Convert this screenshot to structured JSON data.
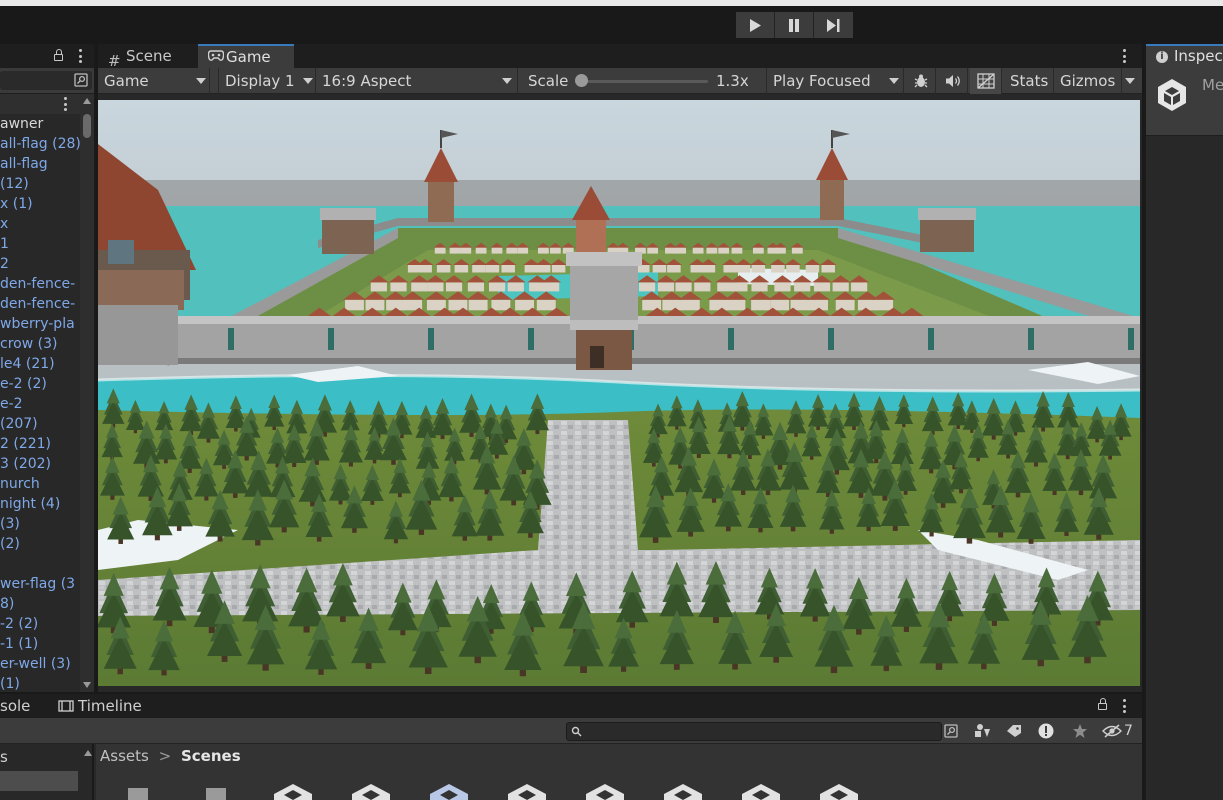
{
  "toolbar": {
    "play_icon": "play-icon",
    "pause_icon": "pause-icon",
    "step_icon": "step-icon"
  },
  "hierarchy": {
    "items": [
      {
        "label": "awner",
        "color": "white"
      },
      {
        "label": "all-flag (28)",
        "color": "blue"
      },
      {
        "label": "all-flag",
        "color": "blue"
      },
      {
        "label": "(12)",
        "color": "blue"
      },
      {
        "label": "x (1)",
        "color": "blue"
      },
      {
        "label": "x",
        "color": "blue"
      },
      {
        "label": "1",
        "color": "blue"
      },
      {
        "label": "2",
        "color": "blue"
      },
      {
        "label": "den-fence-",
        "color": "blue"
      },
      {
        "label": "den-fence-",
        "color": "blue"
      },
      {
        "label": "wberry-pla",
        "color": "blue"
      },
      {
        "label": "crow (3)",
        "color": "blue"
      },
      {
        "label": "le4 (21)",
        "color": "blue"
      },
      {
        "label": "e-2 (2)",
        "color": "blue"
      },
      {
        "label": "e-2",
        "color": "blue"
      },
      {
        "label": " (207)",
        "color": "blue"
      },
      {
        "label": "2 (221)",
        "color": "blue"
      },
      {
        "label": "3 (202)",
        "color": "blue"
      },
      {
        "label": "nurch",
        "color": "blue"
      },
      {
        "label": "night (4)",
        "color": "blue"
      },
      {
        "label": "(3)",
        "color": "blue"
      },
      {
        "label": "(2)",
        "color": "blue"
      },
      {
        "label": "",
        "color": "blue"
      },
      {
        "label": "wer-flag (3",
        "color": "blue"
      },
      {
        "label": "8)",
        "color": "blue"
      },
      {
        "label": "-2 (2)",
        "color": "blue"
      },
      {
        "label": "-1 (1)",
        "color": "blue"
      },
      {
        "label": "er-well (3)",
        "color": "blue"
      },
      {
        "label": " (1)",
        "color": "blue"
      }
    ]
  },
  "game": {
    "tabs": {
      "scene": "Scene",
      "game": "Game"
    },
    "controls": {
      "view": "Game",
      "display": "Display 1",
      "aspect": "16:9 Aspect",
      "scale_label": "Scale",
      "scale_value": "1.3x",
      "play_mode": "Play Focused",
      "stats": "Stats",
      "gizmos": "Gizmos"
    }
  },
  "inspector": {
    "tab": "Inspect",
    "object_name": "Me"
  },
  "bottom": {
    "tabs": {
      "console": "sole",
      "timeline": "Timeline"
    },
    "hidden_count": "7",
    "left_item": "s",
    "breadcrumb": {
      "root": "Assets",
      "separator": ">",
      "current": "Scenes"
    }
  },
  "colors": {
    "accent": "#3a79bb",
    "link_blue": "#7fa8e8",
    "panel": "#282828",
    "toolbar": "#3c3c3c"
  }
}
